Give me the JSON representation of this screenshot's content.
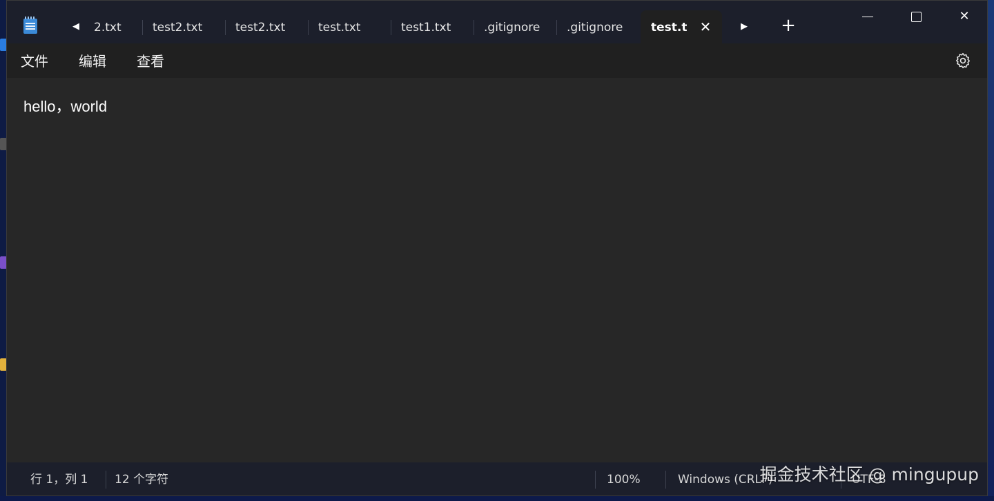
{
  "window": {
    "tabs": [
      {
        "label": "2.txt"
      },
      {
        "label": "test2.txt"
      },
      {
        "label": "test2.txt"
      },
      {
        "label": "test.txt"
      },
      {
        "label": "test1.txt"
      },
      {
        "label": ".gitignore"
      },
      {
        "label": ".gitignore"
      },
      {
        "label": "test.t:",
        "active": true
      }
    ],
    "icons": {
      "scroll_left": "◀",
      "scroll_right": "▶",
      "new_tab": "+",
      "close_tab": "✕",
      "close_window": "✕"
    }
  },
  "menu": {
    "file": "文件",
    "edit": "编辑",
    "view": "查看"
  },
  "editor": {
    "content": "hello，world"
  },
  "status": {
    "position": "行 1，列 1",
    "char_count": "12 个字符",
    "zoom": "100%",
    "line_ending": "Windows (CRLF)",
    "encoding": "UTF-8"
  },
  "watermark": "掘金技术社区 @ mingupup"
}
